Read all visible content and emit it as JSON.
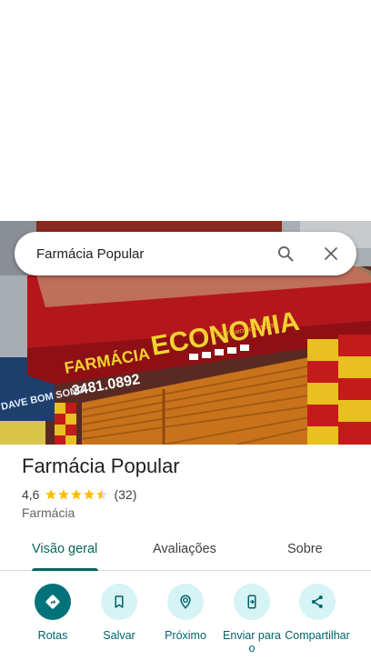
{
  "search": {
    "query": "Farmácia Popular"
  },
  "photo": {
    "sign_main": "FARMÁCIA ECONOMIA",
    "sign_word1": "FARMÁCIA",
    "sign_word2": "ECONOMIA",
    "phone": "3481.0892",
    "cards_notice": "ACEITAMOS CARTÕES",
    "side_sign": "DAVE BOM SONO"
  },
  "place": {
    "name": "Farmácia Popular",
    "rating": "4,6",
    "stars": 4.5,
    "reviews": "(32)",
    "category": "Farmácia"
  },
  "tabs": [
    {
      "label": "Visão geral",
      "active": true
    },
    {
      "label": "Avaliações",
      "active": false
    },
    {
      "label": "Sobre",
      "active": false
    }
  ],
  "actions": [
    {
      "label": "Rotas",
      "icon": "directions-icon"
    },
    {
      "label": "Salvar",
      "icon": "bookmark-icon"
    },
    {
      "label": "Próximo",
      "icon": "nearby-icon"
    },
    {
      "label": "Enviar para o",
      "icon": "send-to-phone-icon"
    },
    {
      "label": "Compartilhar",
      "icon": "share-icon"
    }
  ],
  "colors": {
    "accent": "#00695c",
    "action_bg": "#d6f3f5",
    "primary_action": "#00737a",
    "star": "#fbbc04"
  }
}
